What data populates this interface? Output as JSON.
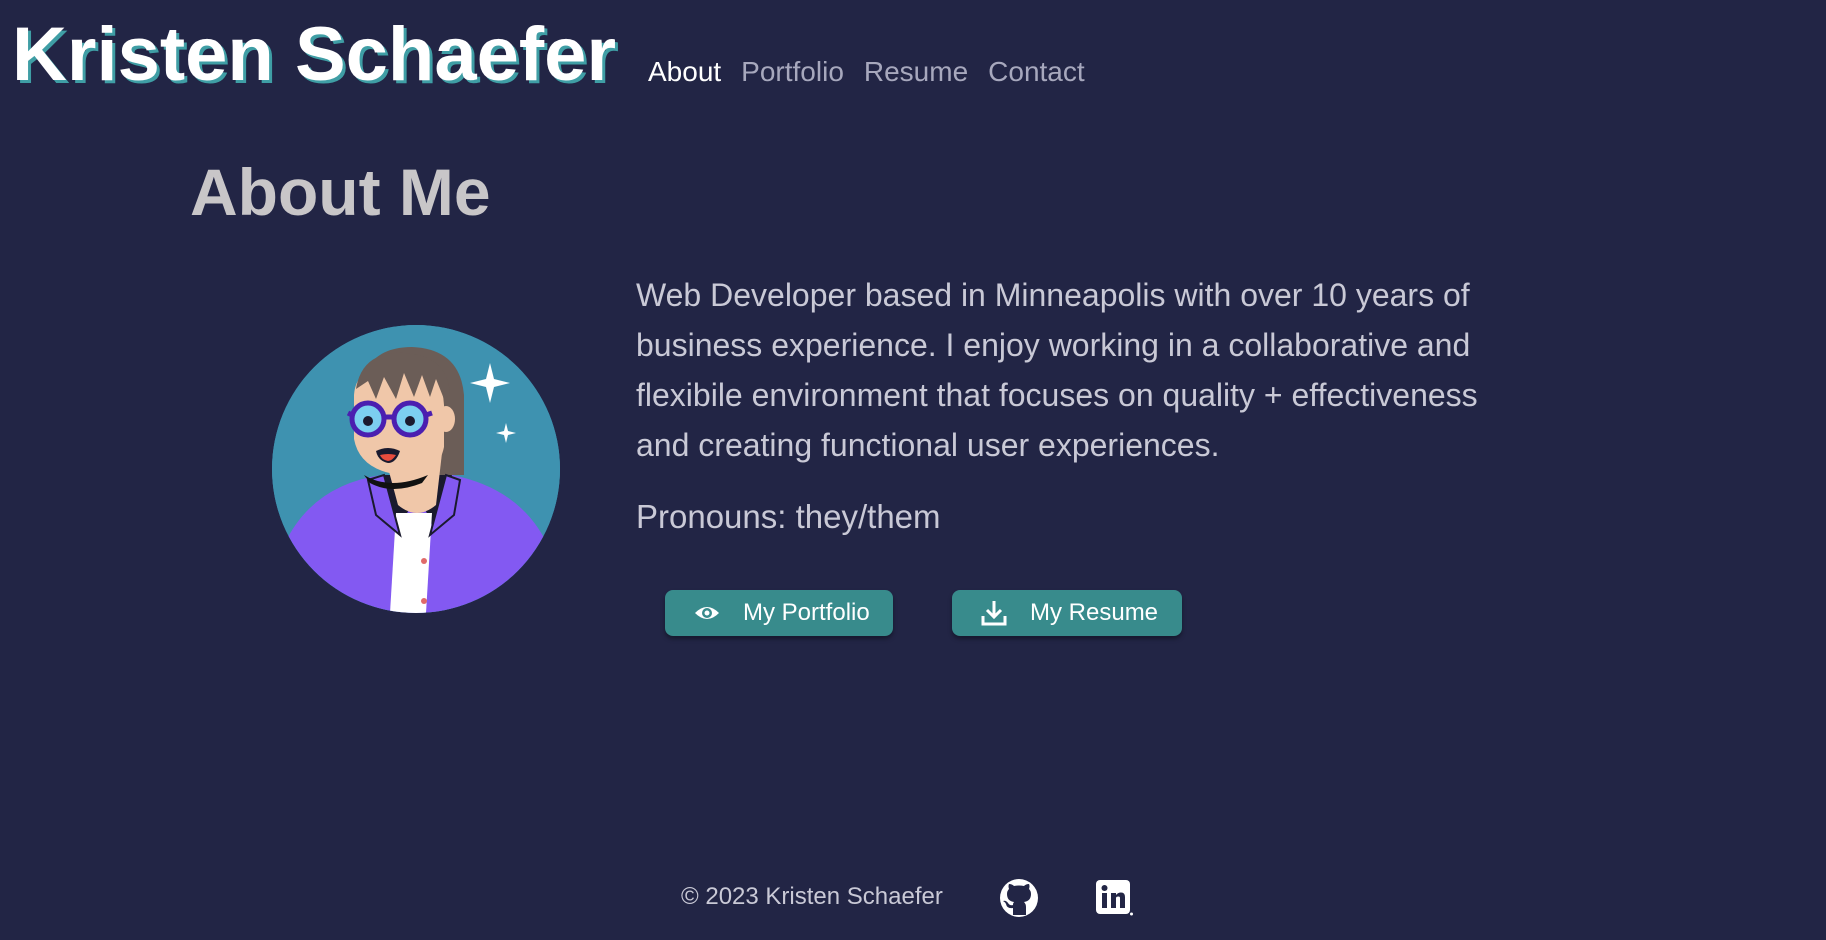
{
  "header": {
    "site_name": "Kristen Schaefer",
    "nav": [
      {
        "label": "About",
        "active": true
      },
      {
        "label": "Portfolio",
        "active": false
      },
      {
        "label": "Resume",
        "active": false
      },
      {
        "label": "Contact",
        "active": false
      }
    ]
  },
  "about": {
    "title": "About Me",
    "bio": "Web Developer based in Minneapolis with over 10 years of business experience. I enjoy working in a collaborative and flexibile environment that focuses on quality + effectiveness and creating functional user experiences.",
    "pronouns": "Pronouns: they/them",
    "buttons": {
      "portfolio_label": "My Portfolio",
      "portfolio_icon": "eye-icon",
      "resume_label": "My Resume",
      "resume_icon": "download-icon"
    },
    "avatar_icon": "avatar-illustration"
  },
  "footer": {
    "copyright": "© 2023 Kristen Schaefer",
    "social": [
      {
        "icon": "github-icon"
      },
      {
        "icon": "linkedin-icon"
      }
    ]
  },
  "colors": {
    "background": "#222545",
    "accent": "#388b8c",
    "title_shadow": "#3f9ea5",
    "text": "#c9c9d6"
  }
}
